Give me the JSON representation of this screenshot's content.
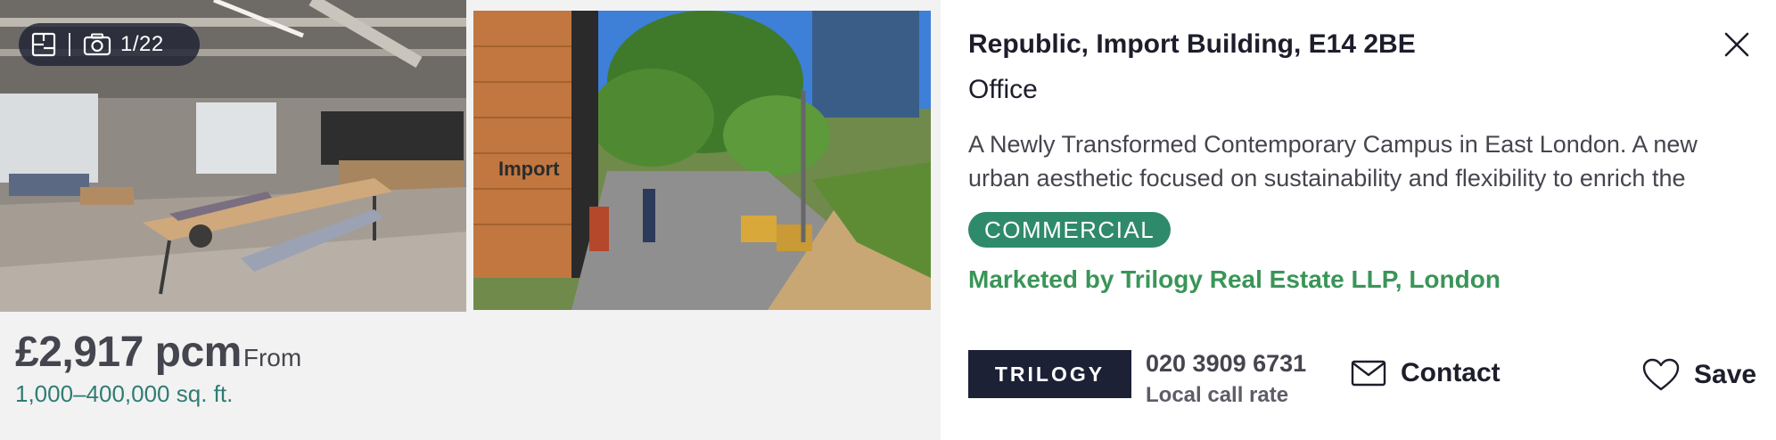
{
  "gallery": {
    "counter": "1/22",
    "floorplan_icon": "floorplan-icon",
    "camera_icon": "camera-icon",
    "photo_1_sign": "Import"
  },
  "listing": {
    "price": "£2,917 pcm",
    "price_qualifier": "From",
    "size": "1,000–400,000 sq. ft.",
    "title": "Republic, Import Building, E14 2BE",
    "property_type": "Office",
    "description": "A Newly Transformed Contemporary Campus in East London. A new urban aesthetic focused on sustainability and flexibility to enrich the",
    "badge": "COMMERCIAL",
    "marketed_by": "Marketed by Trilogy Real Estate LLP, London"
  },
  "agent": {
    "logo_text": "TRILOGY",
    "phone": "020 3909 6731",
    "phone_note": "Local call rate"
  },
  "actions": {
    "contact_label": "Contact",
    "contact_icon": "envelope-icon",
    "save_label": "Save",
    "save_icon": "heart-icon",
    "close_icon": "close-icon"
  },
  "colors": {
    "badge_bg": "#2f8a6b",
    "marketed_text": "#3a9558",
    "size_text": "#2f7c74",
    "logo_bg": "#1c2136"
  }
}
